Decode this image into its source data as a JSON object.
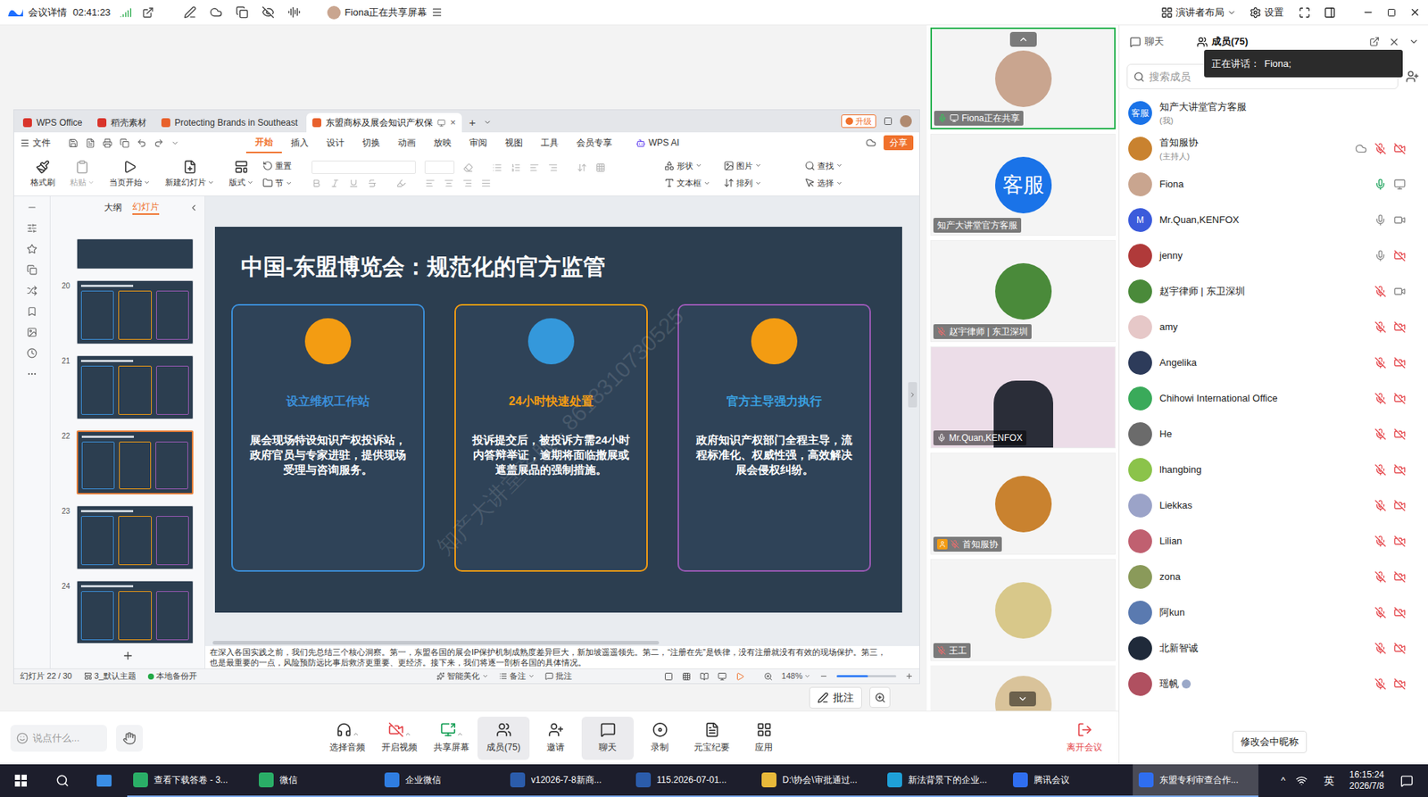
{
  "top_bar": {
    "title": "会议详情",
    "timer": "02:41:23",
    "sharing": "Fiona正在共享屏幕",
    "layout": "演讲者布局",
    "settings": "设置"
  },
  "wps": {
    "tabs": [
      {
        "label": "WPS Office",
        "selected": false,
        "color": "#d9342b"
      },
      {
        "label": "稻壳素材",
        "selected": false,
        "color": "#d9342b"
      },
      {
        "label": "Protecting Brands in Southeast",
        "selected": false,
        "color": "#e8612c"
      },
      {
        "label": "东盟商标及展会知识产权保",
        "selected": true,
        "color": "#e8612c"
      }
    ],
    "tab_close": "×",
    "tab_add": "+",
    "upgrade": "升级",
    "file_menu": "文件",
    "menu": [
      {
        "label": "开始",
        "selected": true
      },
      {
        "label": "插入",
        "selected": false
      },
      {
        "label": "设计",
        "selected": false
      },
      {
        "label": "切换",
        "selected": false
      },
      {
        "label": "动画",
        "selected": false
      },
      {
        "label": "放映",
        "selected": false
      },
      {
        "label": "审阅",
        "selected": false
      },
      {
        "label": "视图",
        "selected": false
      },
      {
        "label": "工具",
        "selected": false
      },
      {
        "label": "会员专享",
        "selected": false
      }
    ],
    "ai": "WPS AI",
    "share": "分享",
    "ribbon_buttons": [
      {
        "label": "格式刷",
        "disabled": false,
        "menu": false
      },
      {
        "label": "粘贴",
        "disabled": true,
        "menu": true
      },
      {
        "label": "当页开始",
        "disabled": false,
        "menu": true
      },
      {
        "label": "新建幻灯片",
        "disabled": false,
        "menu": true
      },
      {
        "label": "版式",
        "disabled": false,
        "menu": true
      }
    ],
    "ribbon_stacks": [
      [
        {
          "label": "重置",
          "menu": false
        },
        {
          "label": "节",
          "menu": true
        }
      ],
      [
        {
          "label": "形状",
          "menu": true
        },
        {
          "label": "文本框",
          "menu": true
        }
      ],
      [
        {
          "label": "图片",
          "menu": true
        },
        {
          "label": "排列",
          "menu": true
        }
      ],
      [
        {
          "label": "查找",
          "menu": true
        },
        {
          "label": "选择",
          "menu": true
        }
      ]
    ],
    "panel_tabs": [
      {
        "label": "大纲",
        "selected": false
      },
      {
        "label": "幻灯片",
        "selected": true
      }
    ],
    "thumbnails": [
      {
        "number": "20",
        "selected": false
      },
      {
        "number": "21",
        "selected": false
      },
      {
        "number": "22",
        "selected": true
      },
      {
        "number": "23",
        "selected": false
      },
      {
        "number": "24",
        "selected": false
      }
    ],
    "slide": {
      "title": "中国-东盟博览会：规范化的官方监管",
      "watermark": "知产大讲堂客服 - 8618310730525",
      "cards": [
        {
          "title": "设立维权工作站",
          "body": "展会现场特设知识产权投诉站，政府官员与专家进驻，提供现场受理与咨询服务。",
          "border": "#3b8fd9",
          "circle": "#f39c12",
          "title_color": "#3b8fd9"
        },
        {
          "title": "24小时快速处置",
          "body": "投诉提交后，被投诉方需24小时内答辩举证，逾期将面临撤展或遮盖展品的强制措施。",
          "border": "#f39c12",
          "circle": "#3498db",
          "title_color": "#f39c12"
        },
        {
          "title": "官方主导强力执行",
          "body": "政府知识产权部门全程主导，流程标准化、权威性强，高效解决展会侵权纠纷。",
          "border": "#9b59b6",
          "circle": "#f39c12",
          "title_color": "#3aa0e0"
        }
      ]
    },
    "notes": [
      "在深入各国实践之前，我们先总结三个核心洞察。第一，东盟各国的展会IP保护机制成熟度差异巨大，新加坡遥遥领先。第二，“注册在先”是铁律，没有注册就没有有效的现场保护。第三，",
      "也是最重要的一点，风险预防远比事后救济更重要、更经济。接下来，我们将逐一剖析各国的具体情况。"
    ],
    "status_bar": {
      "slide": "幻灯片 22 / 30",
      "theme": "3_默认主题",
      "backup": "本地备份开",
      "beautify": "智能美化",
      "notes": "备注",
      "comments": "批注",
      "zoom": "148%",
      "zoom_level": 0.53
    }
  },
  "annotate": "批注",
  "videos": [
    {
      "name": "Fiona正在共享",
      "kind": "avatar",
      "speaking": true,
      "muted": false,
      "host": false,
      "sharing": true,
      "color": "#c9a58f",
      "avatar_text": ""
    },
    {
      "name": "知产大讲堂官方客服",
      "kind": "avatar",
      "speaking": false,
      "muted": false,
      "host": false,
      "sharing": false,
      "color": "#1a73e8",
      "avatar_text": "客服"
    },
    {
      "name": "赵宇律师 | 东卫深圳",
      "kind": "avatar",
      "speaking": false,
      "muted": true,
      "host": false,
      "sharing": false,
      "color": "#4a8a3a",
      "avatar_text": ""
    },
    {
      "name": "Mr.Quan,KENFOX",
      "kind": "video",
      "speaking": false,
      "muted": false,
      "host": false,
      "sharing": false,
      "color": "#ecdde8",
      "avatar_text": ""
    },
    {
      "name": "首知服协",
      "kind": "avatar",
      "speaking": false,
      "muted": true,
      "host": true,
      "sharing": false,
      "color": "#c9822f",
      "avatar_text": ""
    },
    {
      "name": "王工",
      "kind": "avatar",
      "speaking": false,
      "muted": true,
      "host": false,
      "sharing": false,
      "color": "#d8c88a",
      "avatar_text": ""
    }
  ],
  "toolbar": {
    "chat_placeholder": "说点什么...",
    "buttons": [
      {
        "label": "选择音频",
        "selected": false,
        "menu": true
      },
      {
        "label": "开启视频",
        "selected": false,
        "menu": true
      },
      {
        "label": "共享屏幕",
        "selected": false,
        "menu": true
      },
      {
        "label": "成员(75)",
        "selected": true,
        "menu": false
      },
      {
        "label": "邀请",
        "selected": false,
        "menu": false
      },
      {
        "label": "聊天",
        "selected": true,
        "menu": false
      },
      {
        "label": "录制",
        "selected": false,
        "menu": false
      },
      {
        "label": "元宝纪要",
        "selected": false,
        "menu": false
      },
      {
        "label": "应用",
        "selected": false,
        "menu": false
      }
    ],
    "leave": "离开会议"
  },
  "panel": {
    "tabs": [
      {
        "label": "聊天",
        "selected": false
      },
      {
        "label": "成员(75)",
        "selected": true
      }
    ],
    "speaking_label": "正在讲话：",
    "speaking": "Fiona;",
    "search_placeholder": "搜索成员",
    "rename": "修改会中昵称",
    "members": [
      {
        "name": "知产大讲堂官方客服",
        "note": "(我)",
        "mic": "none",
        "camera": "none",
        "cloud": false,
        "badge": false,
        "color": "#1a73e8",
        "avatar_text": "客服"
      },
      {
        "name": "首知服协",
        "note": "(主持人)",
        "mic": "muted",
        "camera": "off",
        "cloud": true,
        "badge": false,
        "color": "#c9822f",
        "avatar_text": ""
      },
      {
        "name": "Fiona",
        "note": "",
        "mic": "speaking",
        "camera": "sharing",
        "cloud": false,
        "badge": false,
        "color": "#c9a58f",
        "avatar_text": ""
      },
      {
        "name": "Mr.Quan,KENFOX",
        "note": "",
        "mic": "on",
        "camera": "on",
        "cloud": false,
        "badge": false,
        "color": "#3b5bdb",
        "avatar_text": "M"
      },
      {
        "name": "jenny",
        "note": "",
        "mic": "on",
        "camera": "off",
        "cloud": false,
        "badge": false,
        "color": "#b03a3a",
        "avatar_text": ""
      },
      {
        "name": "赵宇律师 | 东卫深圳",
        "note": "",
        "mic": "muted",
        "camera": "on",
        "cloud": false,
        "badge": false,
        "color": "#4a8a3a",
        "avatar_text": ""
      },
      {
        "name": "amy",
        "note": "",
        "mic": "muted",
        "camera": "off",
        "cloud": false,
        "badge": false,
        "color": "#e6c8c8",
        "avatar_text": ""
      },
      {
        "name": "Angelika",
        "note": "",
        "mic": "muted",
        "camera": "off",
        "cloud": false,
        "badge": false,
        "color": "#2d3b5a",
        "avatar_text": ""
      },
      {
        "name": "Chihowi International Office",
        "note": "",
        "mic": "muted",
        "camera": "off",
        "cloud": false,
        "badge": false,
        "color": "#3aaa5a",
        "avatar_text": ""
      },
      {
        "name": "He",
        "note": "",
        "mic": "muted",
        "camera": "off",
        "cloud": false,
        "badge": false,
        "color": "#6b6b6b",
        "avatar_text": ""
      },
      {
        "name": "lhangbing",
        "note": "",
        "mic": "muted",
        "camera": "off",
        "cloud": false,
        "badge": false,
        "color": "#8bc34a",
        "avatar_text": ""
      },
      {
        "name": "Liekkas",
        "note": "",
        "mic": "muted",
        "camera": "off",
        "cloud": false,
        "badge": false,
        "color": "#9ba3c8",
        "avatar_text": ""
      },
      {
        "name": "Lilian",
        "note": "",
        "mic": "muted",
        "camera": "off",
        "cloud": false,
        "badge": false,
        "color": "#c06070",
        "avatar_text": ""
      },
      {
        "name": "zona",
        "note": "",
        "mic": "muted",
        "camera": "off",
        "cloud": false,
        "badge": false,
        "color": "#8a9a5a",
        "avatar_text": ""
      },
      {
        "name": "阿kun",
        "note": "",
        "mic": "muted",
        "camera": "off",
        "cloud": false,
        "badge": false,
        "color": "#5a7ab0",
        "avatar_text": ""
      },
      {
        "name": "北新智诚",
        "note": "",
        "mic": "muted",
        "camera": "off",
        "cloud": false,
        "badge": false,
        "color": "#1f2a3a",
        "avatar_text": ""
      },
      {
        "name": "瑶帆",
        "note": "",
        "mic": "muted",
        "camera": "off",
        "cloud": false,
        "badge": true,
        "color": "#b05060",
        "avatar_text": ""
      }
    ]
  },
  "taskbar": {
    "items": [
      {
        "label": "查看下载答卷 - 3...",
        "selected": false,
        "color": "#2aae67"
      },
      {
        "label": "微信",
        "selected": false,
        "color": "#2aae67"
      },
      {
        "label": "企业微信",
        "selected": false,
        "color": "#2f7de1"
      },
      {
        "label": "v12026-7-8新商...",
        "selected": false,
        "color": "#2b5cab"
      },
      {
        "label": "115.2026-07-01...",
        "selected": false,
        "color": "#2b5cab"
      },
      {
        "label": "D:\\协会\\审批通过...",
        "selected": false,
        "color": "#e8b93a"
      },
      {
        "label": "新法背景下的企业...",
        "selected": false,
        "color": "#1fa0d8"
      },
      {
        "label": "腾讯会议",
        "selected": false,
        "color": "#2f6ef0"
      },
      {
        "label": "东盟专利审查合作...",
        "selected": true,
        "color": "#2f6ef0"
      }
    ],
    "tray_up": "^",
    "ime": "英",
    "time": "16:15:24",
    "date": "2026/7/8"
  }
}
